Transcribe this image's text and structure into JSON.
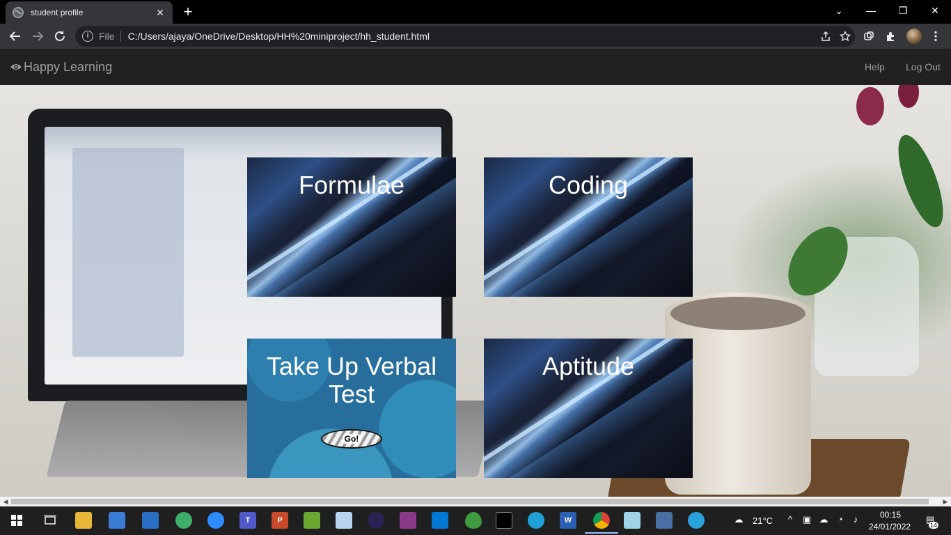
{
  "browser": {
    "tab_title": "student profile",
    "tab_close": "✕",
    "new_tab": "+",
    "scheme_label": "File",
    "url": "C:/Users/ajaya/OneDrive/Desktop/HH%20miniproject/hh_student.html"
  },
  "navbar": {
    "brand": "Happy Learning",
    "links": [
      "Help",
      "Log Out"
    ]
  },
  "cards": [
    {
      "title": "Formulae",
      "style": "dark"
    },
    {
      "title": "Coding",
      "style": "dark"
    },
    {
      "title": "Take Up Verbal Test",
      "style": "blue",
      "button": "Go!"
    },
    {
      "title": "Aptitude",
      "style": "dark"
    }
  ],
  "taskbar": {
    "weather": "21°C",
    "time": "00:15",
    "date": "24/01/2022",
    "notifications": "14",
    "apps": [
      "start",
      "task-view",
      "file-explorer",
      "this-pc",
      "news",
      "atom",
      "zoom",
      "teams",
      "powerpoint",
      "minecraft",
      "paint",
      "eclipse",
      "winrar",
      "vscode",
      "mongodb",
      "terminal",
      "edge",
      "word",
      "chrome",
      "notepad",
      "virtualbox",
      "telegram"
    ]
  },
  "colors": {
    "navbar_bg": "#212121",
    "navbar_text": "#9d9d9d",
    "card_blue": "#276e9d"
  }
}
